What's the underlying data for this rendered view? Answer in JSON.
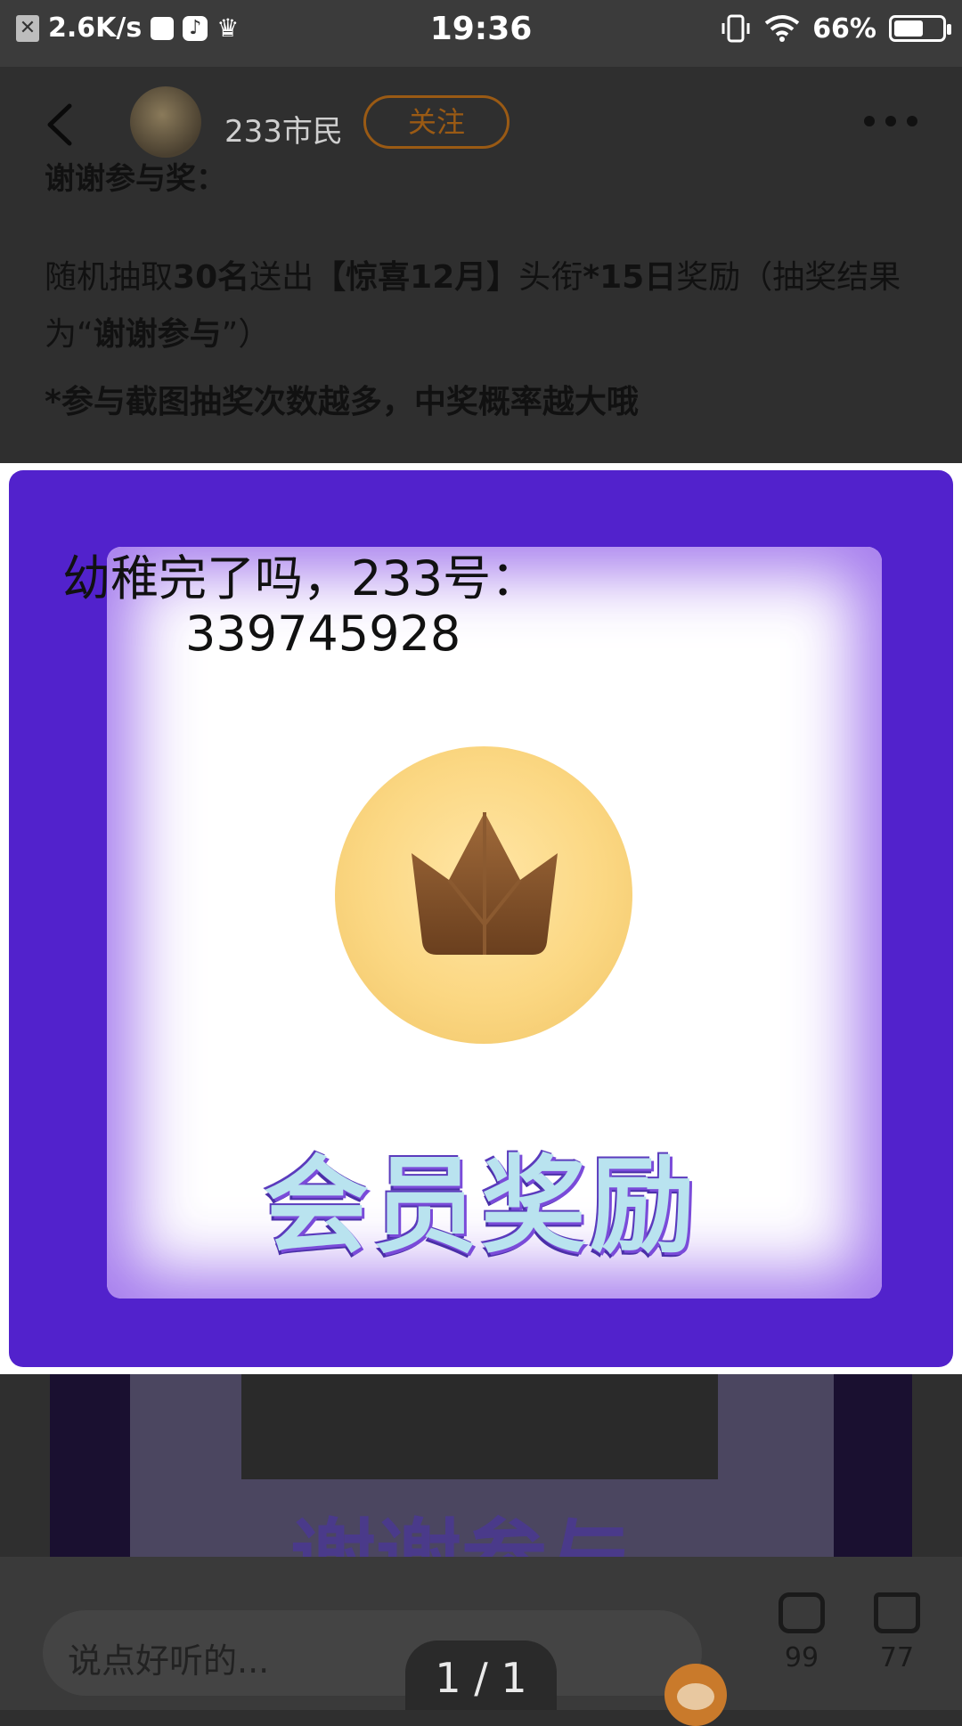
{
  "status_bar": {
    "net_speed": "2.6K/s",
    "time": "19:36",
    "battery": "66%",
    "battery_level": 0.66
  },
  "header": {
    "username": "233市民",
    "follow_label": "关注"
  },
  "post": {
    "clipped_line": "谢谢参与奖：",
    "p1_a": "随机抽取",
    "p1_b": "30名",
    "p1_c": "送出",
    "p1_d": "【惊喜12月】",
    "p1_e": "头衔",
    "p1_f": "*15日",
    "p1_g": "奖励（抽奖结果为“",
    "p1_h": "谢谢参与",
    "p1_i": "”）",
    "p2": "*参与截图抽奖次数越多，中奖概率越大哦"
  },
  "image": {
    "overlay_line1": "幼稚完了吗，233号：",
    "overlay_line2": "339745928",
    "reward_text": "会员奖励",
    "peek_text": "谢谢参与"
  },
  "bottom": {
    "input_placeholder": "说点好听的...",
    "comment_count": "99",
    "like_count": "77",
    "pager": "1 / 1"
  },
  "icons": {
    "back": "chevron-left-icon",
    "more": "more-dots-icon",
    "comment": "comment-icon",
    "like": "thumbs-up-icon",
    "crown": "crown-icon",
    "mascot": "mascot-icon"
  },
  "colors": {
    "card_purple": "#5222cc",
    "follow_brown": "#9a5a14",
    "coin_gold": "#fbd782"
  }
}
